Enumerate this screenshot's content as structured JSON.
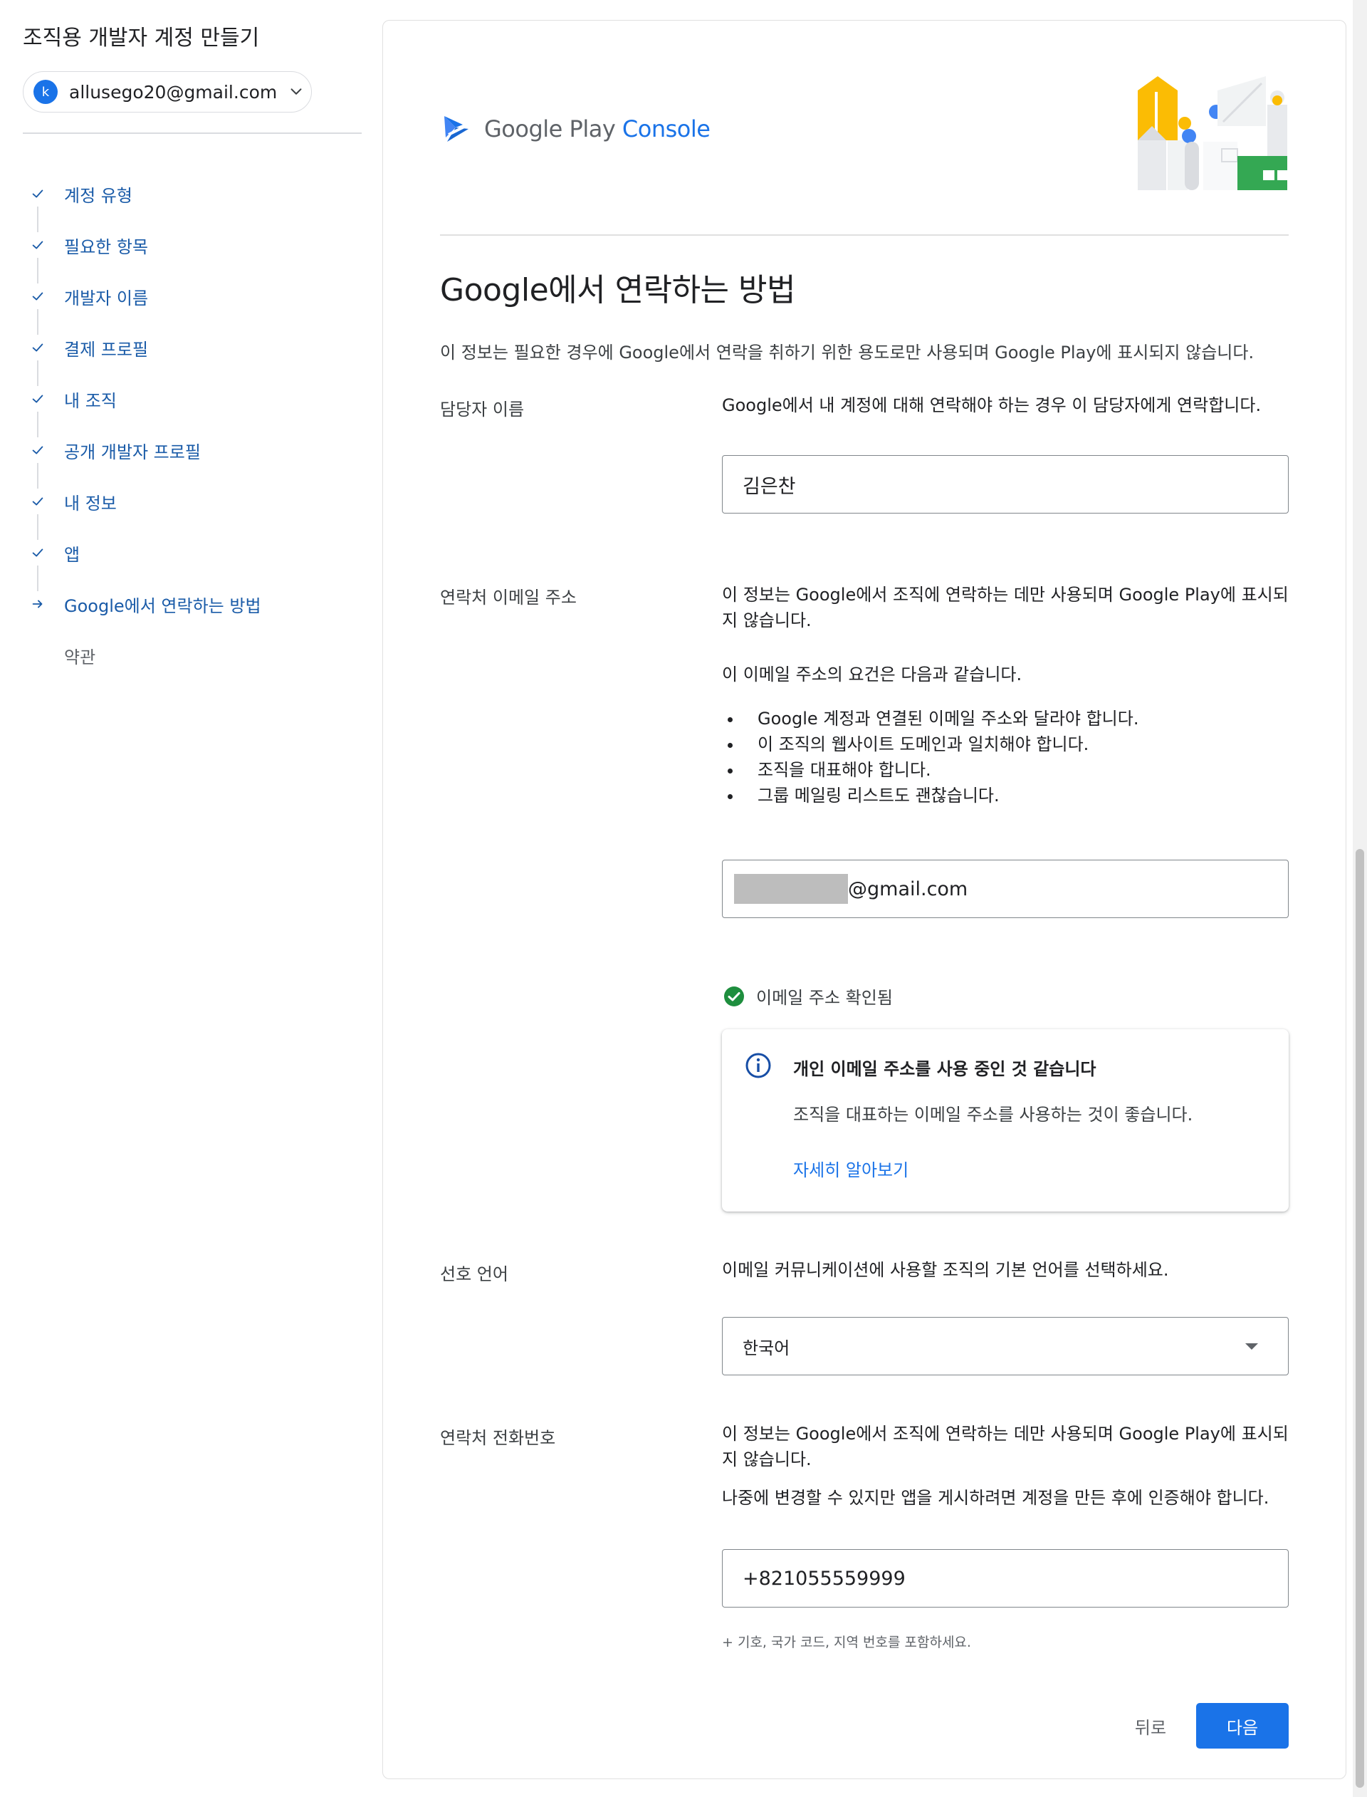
{
  "colors": {
    "accent": "#1a73e8",
    "step_link": "#1a5ba8",
    "success": "#1e8e3e",
    "info": "#174ea6"
  },
  "sidebar": {
    "title": "조직용 개발자 계정 만들기",
    "account": {
      "avatar_letter": "k",
      "email": "allusego20@gmail.com"
    },
    "steps": [
      {
        "label": "계정 유형",
        "status": "done"
      },
      {
        "label": "필요한 항목",
        "status": "done"
      },
      {
        "label": "개발자 이름",
        "status": "done"
      },
      {
        "label": "결제 프로필",
        "status": "done"
      },
      {
        "label": "내 조직",
        "status": "done"
      },
      {
        "label": "공개 개발자 프로필",
        "status": "done"
      },
      {
        "label": "내 정보",
        "status": "done"
      },
      {
        "label": "앱",
        "status": "done"
      },
      {
        "label": "Google에서 연락하는 방법",
        "status": "current"
      },
      {
        "label": "약관",
        "status": "pending"
      }
    ]
  },
  "logo": {
    "prefix": "Google Play",
    "suffix": "Console"
  },
  "page": {
    "title": "Google에서 연락하는 방법",
    "description": "이 정보는 필요한 경우에 Google에서 연락을 취하기 위한 용도로만 사용되며 Google Play에 표시되지 않습니다."
  },
  "contact_name": {
    "label": "담당자 이름",
    "description": "Google에서 내 계정에 대해 연락해야 하는 경우 이 담당자에게 연락합니다.",
    "value": "김은찬"
  },
  "contact_email": {
    "label": "연락처 이메일 주소",
    "description": "이 정보는 Google에서 조직에 연락하는 데만 사용되며 Google Play에 표시되지 않습니다.",
    "requirements_intro": "이 이메일 주소의 요건은 다음과 같습니다.",
    "requirements": [
      "Google 계정과 연결된 이메일 주소와 달라야 합니다.",
      "이 조직의 웹사이트 도메인과 일치해야 합니다.",
      "조직을 대표해야 합니다.",
      "그룹 메일링 리스트도 괜찮습니다."
    ],
    "value_suffix": "@gmail.com",
    "verified_text": "이메일 주소 확인됨",
    "notice": {
      "title": "개인 이메일 주소를 사용 중인 것 같습니다",
      "body": "조직을 대표하는 이메일 주소를 사용하는 것이 좋습니다.",
      "link": "자세히 알아보기"
    }
  },
  "language": {
    "label": "선호 언어",
    "description": "이메일 커뮤니케이션에 사용할 조직의 기본 언어를 선택하세요.",
    "selected": "한국어"
  },
  "phone": {
    "label": "연락처 전화번호",
    "description": "이 정보는 Google에서 조직에 연락하는 데만 사용되며 Google Play에 표시되지 않습니다.",
    "note": "나중에 변경할 수 있지만 앱을 게시하려면 계정을 만든 후에 인증해야 합니다.",
    "value": "+821055559999",
    "hint": "+ 기호, 국가 코드, 지역 번호를 포함하세요."
  },
  "actions": {
    "back": "뒤로",
    "next": "다음"
  }
}
